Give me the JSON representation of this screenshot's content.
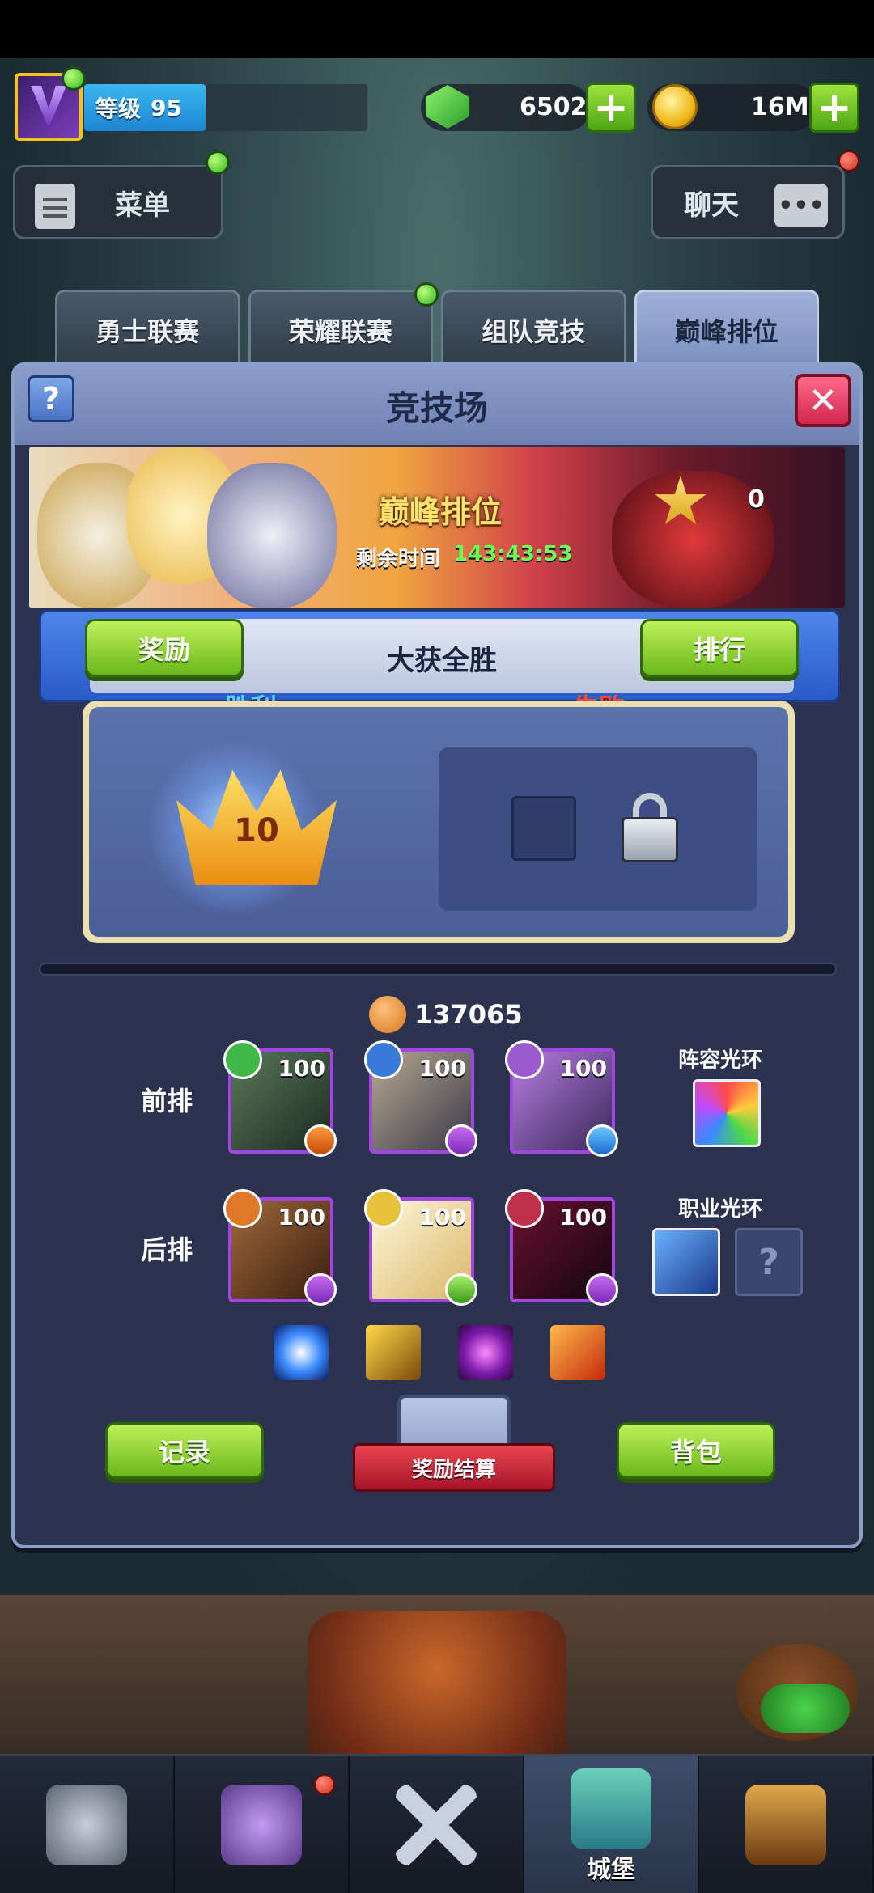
{
  "hud": {
    "level_label": "等级",
    "level_value": "95",
    "gems": "6502",
    "gold": "16M",
    "menu_label": "菜单",
    "chat_label": "聊天"
  },
  "tabs": [
    {
      "label": "勇士联赛",
      "active": false
    },
    {
      "label": "荣耀联赛",
      "active": false,
      "notify": true
    },
    {
      "label": "组队竞技",
      "active": false
    },
    {
      "label": "巅峰排位",
      "active": true
    }
  ],
  "arena": {
    "title": "竞技场",
    "help": "?",
    "close": "✕",
    "banner": {
      "title": "巅峰排位",
      "time_label": "剩余时间",
      "time_value": "143:43:53",
      "rank_points": "0"
    },
    "ribbon": {
      "reward_button": "奖励",
      "title": "大获全胜",
      "rank_button": "排行"
    },
    "result": {
      "win_label": "胜利",
      "lose_label": "失败",
      "win_count": "10"
    },
    "power": "137065",
    "lineup": {
      "front_label": "前排",
      "back_label": "后排",
      "front": [
        {
          "level": "100",
          "faction_color": "#3fb84a",
          "cls_icon": "fist-icon"
        },
        {
          "level": "100",
          "faction_color": "#3a7ad8",
          "cls_icon": "claw-icon"
        },
        {
          "level": "100",
          "faction_color": "#9a5ad0",
          "cls_icon": "bow-icon"
        }
      ],
      "back": [
        {
          "level": "100",
          "faction_color": "#e0782a",
          "cls_icon": "claw-icon"
        },
        {
          "level": "100",
          "faction_color": "#e6c23a",
          "cls_icon": "heal-icon"
        },
        {
          "level": "100",
          "faction_color": "#c0304a",
          "cls_icon": "claw-icon"
        }
      ],
      "team_aura_label": "阵容光环",
      "class_aura_label": "职业光环",
      "class_aura_unknown": "?"
    },
    "buttons": {
      "records": "记录",
      "reward_settle": "奖励结算",
      "backpack": "背包"
    }
  },
  "bottom_nav": [
    {
      "name": "heroes",
      "label": "",
      "icon": "knight-helmet-icon"
    },
    {
      "name": "guild",
      "label": "",
      "icon": "guild-icon",
      "notify": true
    },
    {
      "name": "battle",
      "label": "",
      "icon": "crossed-swords-icon"
    },
    {
      "name": "castle",
      "label": "城堡",
      "icon": "castle-icon",
      "active": true
    },
    {
      "name": "inventory",
      "label": "",
      "icon": "chest-icon"
    }
  ]
}
